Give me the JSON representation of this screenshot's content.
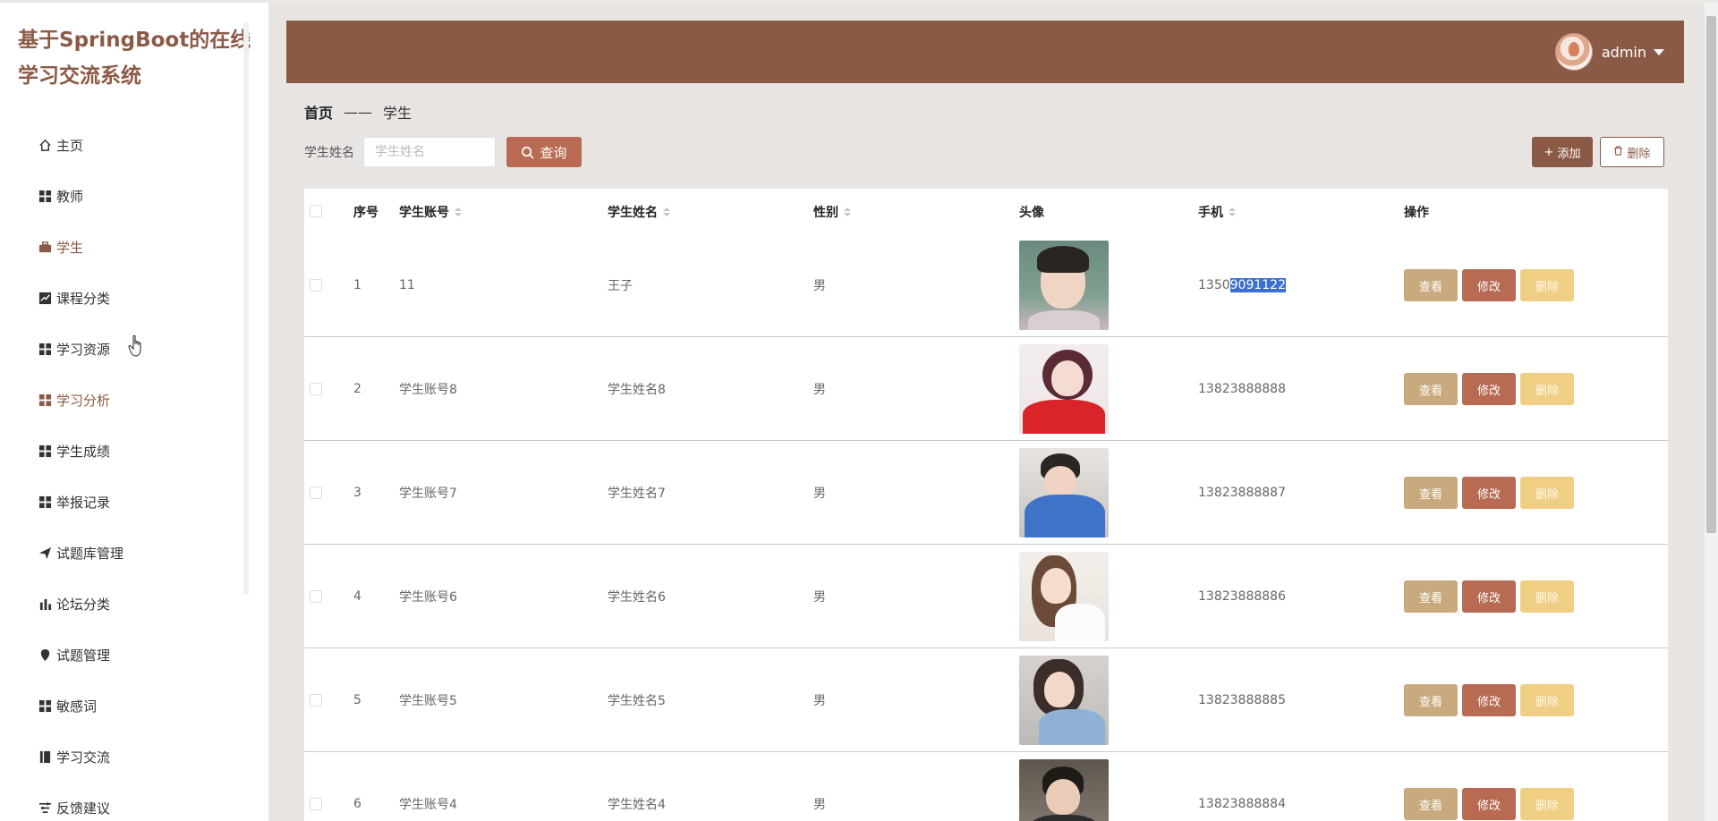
{
  "app": {
    "title": "基于SpringBoot的在线学习交流系统"
  },
  "sidebar": {
    "items": [
      {
        "label": "主页",
        "icon": "home-icon"
      },
      {
        "label": "教师",
        "icon": "grid-icon"
      },
      {
        "label": "学生",
        "icon": "briefcase-icon"
      },
      {
        "label": "课程分类",
        "icon": "chart-icon"
      },
      {
        "label": "学习资源",
        "icon": "grid-icon"
      },
      {
        "label": "学习分析",
        "icon": "grid-icon"
      },
      {
        "label": "学生成绩",
        "icon": "grid-icon"
      },
      {
        "label": "举报记录",
        "icon": "grid-icon"
      },
      {
        "label": "试题库管理",
        "icon": "send-icon"
      },
      {
        "label": "论坛分类",
        "icon": "bar-chart-icon"
      },
      {
        "label": "试题管理",
        "icon": "location-icon"
      },
      {
        "label": "敏感词",
        "icon": "grid-icon"
      },
      {
        "label": "学习交流",
        "icon": "book-icon"
      },
      {
        "label": "反馈建议",
        "icon": "filter-icon"
      }
    ]
  },
  "header": {
    "username": "admin"
  },
  "breadcrumb": {
    "home": "首页",
    "separator": "——",
    "current": "学生"
  },
  "search": {
    "label": "学生姓名",
    "placeholder": "学生姓名",
    "query_label": "查询"
  },
  "toolbar": {
    "add_label": "添加",
    "delete_label": "删除"
  },
  "table": {
    "columns": {
      "index": "序号",
      "account": "学生账号",
      "name": "学生姓名",
      "gender": "性别",
      "avatar": "头像",
      "phone": "手机",
      "actions": "操作"
    },
    "action_labels": {
      "view": "查看",
      "edit": "修改",
      "remove": "删除"
    },
    "rows": [
      {
        "index": "1",
        "account": "11",
        "name": "王子",
        "gender": "男",
        "phone_a": "1350",
        "phone_b": "9091122"
      },
      {
        "index": "2",
        "account": "学生账号8",
        "name": "学生姓名8",
        "gender": "男",
        "phone_a": "13823888888",
        "phone_b": ""
      },
      {
        "index": "3",
        "account": "学生账号7",
        "name": "学生姓名7",
        "gender": "男",
        "phone_a": "13823888887",
        "phone_b": ""
      },
      {
        "index": "4",
        "account": "学生账号6",
        "name": "学生姓名6",
        "gender": "男",
        "phone_a": "13823888886",
        "phone_b": ""
      },
      {
        "index": "5",
        "account": "学生账号5",
        "name": "学生姓名5",
        "gender": "男",
        "phone_a": "13823888885",
        "phone_b": ""
      },
      {
        "index": "6",
        "account": "学生账号4",
        "name": "学生姓名4",
        "gender": "男",
        "phone_a": "13823888884",
        "phone_b": ""
      }
    ]
  },
  "colors": {
    "brand": "#8b5a46",
    "query": "#b86a53",
    "view": "#c9a97e",
    "edit": "#b86a53",
    "remove": "#f0cf84"
  }
}
